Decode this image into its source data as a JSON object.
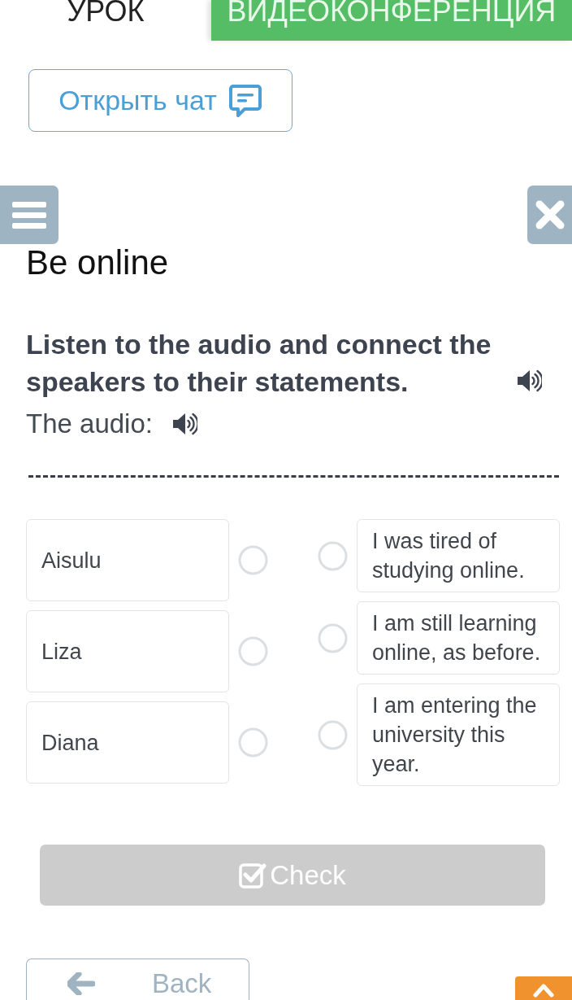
{
  "tabs": [
    {
      "label": "УРОК",
      "selected": false
    },
    {
      "label": "ВИДЕОКОНФЕРЕНЦИЯ",
      "selected": true
    }
  ],
  "chat_button": {
    "label": "Открыть чат"
  },
  "lesson": {
    "title": "Be online",
    "instruction": "Listen to the audio and connect the speakers to their statements.",
    "audio_label": "The audio:"
  },
  "match": {
    "speakers": [
      {
        "label": "Aisulu"
      },
      {
        "label": "Liza"
      },
      {
        "label": "Diana"
      }
    ],
    "statements": [
      {
        "label": "I was tired of studying online."
      },
      {
        "label": "I am still learning online, as before."
      },
      {
        "label": "I am entering the university this year."
      }
    ]
  },
  "check_button": {
    "label": "Check",
    "disabled": true
  },
  "back_button": {
    "label": "Back"
  }
}
